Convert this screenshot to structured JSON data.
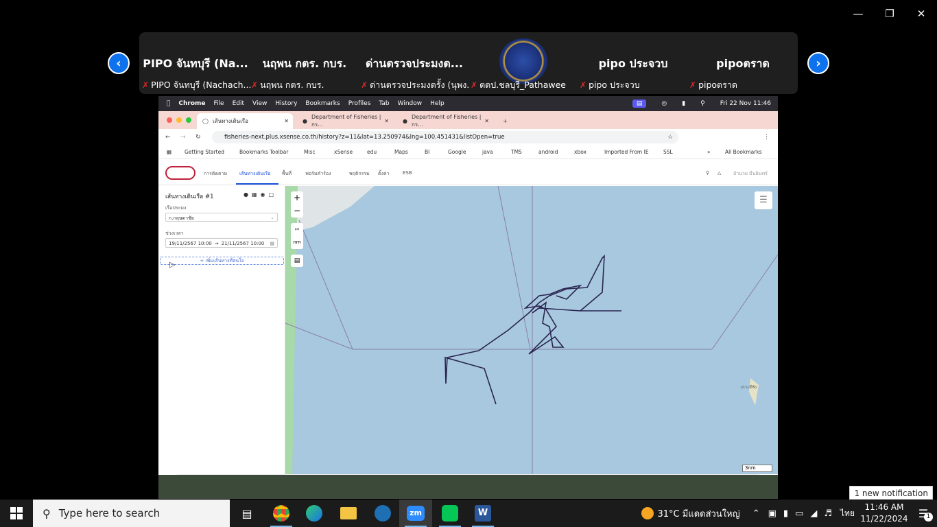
{
  "participants": [
    {
      "big": "PIPO จันทบุรี (Na...",
      "caption": "PIPO จันทบุรี (Nachach..."
    },
    {
      "big": "นฤพน  กตร. กบร.",
      "caption": "นฤพน  กตร. กบร."
    },
    {
      "big": "ด่านตรวจประมงต...",
      "caption": "ด่านตรวจประมงตรั้ง (นุพง..."
    },
    {
      "big": "",
      "caption": "ตตป.ชลบุรี_Pathawee"
    },
    {
      "big": "pipo ประจวบ",
      "caption": "pipo ประจวบ"
    },
    {
      "big": "pipoตราด",
      "caption": "pipoตราด"
    }
  ],
  "mac_menu": [
    "Chrome",
    "File",
    "Edit",
    "View",
    "History",
    "Bookmarks",
    "Profiles",
    "Tab",
    "Window",
    "Help"
  ],
  "mac_clock": "Fri 22 Nov  11:46",
  "tabs": [
    {
      "label": "เส้นทางเดินเรือ"
    },
    {
      "label": "Department of Fisheries | กร..."
    },
    {
      "label": "Department of Fisheries | กร..."
    }
  ],
  "url": "fisheries-next.plus.xsense.co.th/history?z=11&lat=13.250974&lng=100.451431&listOpen=true",
  "bookmarks": [
    "Getting Started",
    "Bookmarks Toolbar",
    "Misc",
    "xSense",
    "edu",
    "Maps",
    "BI",
    "Google",
    "java",
    "TMS",
    "android",
    "xbox",
    "Imported From IE",
    "SSL"
  ],
  "bookmarks_more": "»",
  "all_bookmarks": "All Bookmarks",
  "app_nav": [
    "การติดตาม",
    "เส้นทางเดินเรือ",
    "พื้นที่",
    "ฟอร์มคำร้อง",
    "พฤติกรรม",
    "ตั้งค่า",
    "ESB"
  ],
  "app_user": "อำนวย มีนยินทร์",
  "panel": {
    "title": "เส้นทางเดินเรือ #1",
    "vessel_label": "เรือประมง",
    "vessel_value": "ก.กฤษดาชัย",
    "period_label": "ช่วงเวลา",
    "date_from": "19/11/2567 10:00",
    "date_sep": "→",
    "date_to": "21/11/2567 10:00",
    "add_route": "+ เพิ่มเส้นทางที่สนใจ"
  },
  "map": {
    "zoom_in": "+",
    "zoom_out": "−",
    "ruler": "↦",
    "unit": "nm",
    "scale": "3nm",
    "place_label": "เกาะสีชัง"
  },
  "notification": "1 new notification",
  "taskbar": {
    "search_placeholder": "Type here to search",
    "weather": "31°C  มีแดดส่วนใหญ่",
    "lang": "ไทย",
    "time": "11:46 AM",
    "date": "11/22/2024",
    "notif_count": "1"
  }
}
